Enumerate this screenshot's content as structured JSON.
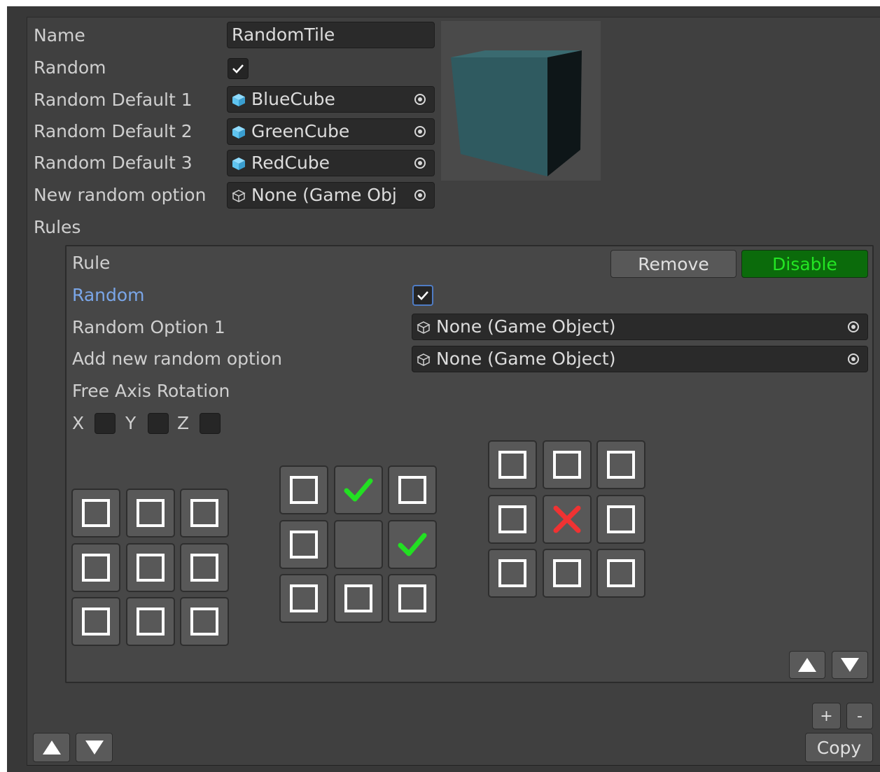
{
  "tile": {
    "name_label": "Name",
    "name_value": "RandomTile",
    "random_label": "Random",
    "random_checked": true,
    "defaults": [
      {
        "label": "Random Default 1",
        "value": "BlueCube",
        "icon": "blue-cube-icon",
        "icon_color": "#5fc4f0"
      },
      {
        "label": "Random Default 2",
        "value": "GreenCube",
        "icon": "blue-cube-icon",
        "icon_color": "#5fc4f0"
      },
      {
        "label": "Random Default 3",
        "value": "RedCube",
        "icon": "blue-cube-icon",
        "icon_color": "#5fc4f0"
      }
    ],
    "new_option_label": "New random option",
    "new_option_value": "None (Game Obj",
    "rules_label": "Rules"
  },
  "rule": {
    "title": "Rule",
    "remove_label": "Remove",
    "disable_label": "Disable",
    "random_label": "Random",
    "random_checked": true,
    "option1_label": "Random Option 1",
    "option1_value": "None (Game Object)",
    "add_option_label": "Add new random option",
    "add_option_value": "None (Game Object)",
    "free_axis_label": "Free Axis Rotation",
    "axes": [
      "X",
      "Y",
      "Z"
    ]
  },
  "grids": {
    "grid1": [
      "square",
      "square",
      "square",
      "square",
      "square",
      "square",
      "square",
      "square",
      "square"
    ],
    "grid2": [
      "square",
      "check",
      "square",
      "square",
      "empty",
      "check",
      "square",
      "square",
      "square"
    ],
    "grid3": [
      "square",
      "square",
      "square",
      "square",
      "cross",
      "square",
      "square",
      "square",
      "square"
    ]
  },
  "footer": {
    "plus_label": "+",
    "minus_label": "-",
    "copy_label": "Copy"
  },
  "colors": {
    "accent_blue_label": "#7aa6e8",
    "disable_bg": "#0b6b0b",
    "disable_text": "#23e523",
    "check_green": "#22e022",
    "cross_red": "#f03232",
    "cube_face": "#2f5a60"
  }
}
